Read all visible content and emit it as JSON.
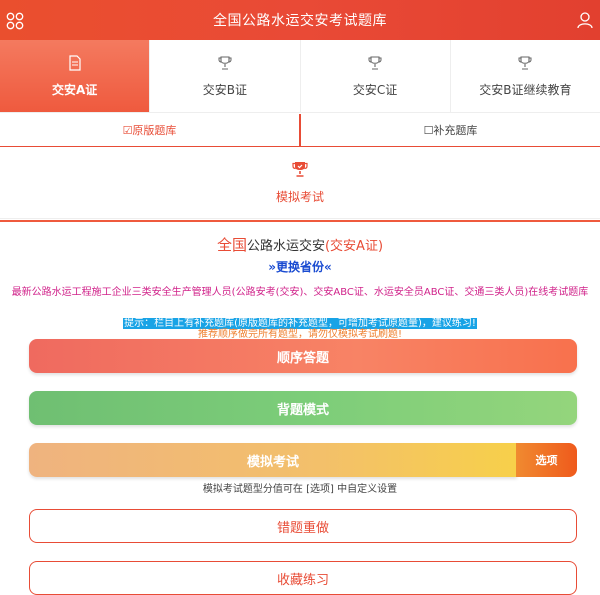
{
  "header": {
    "title": "全国公路水运交安考试题库"
  },
  "tabs": [
    {
      "label": "交安A证",
      "active": true
    },
    {
      "label": "交安B证",
      "active": false
    },
    {
      "label": "交安C证",
      "active": false
    },
    {
      "label": "交安B证继续教育",
      "active": false
    }
  ],
  "subtabs": [
    {
      "label": "☑原版题库",
      "active": true
    },
    {
      "label": "☐补充题库",
      "active": false
    }
  ],
  "mock_exam_tab": {
    "label": "模拟考试"
  },
  "info": {
    "title_prefix": "全国",
    "title_mid": "公路水运交安",
    "title_suffix": "(交安A证)",
    "change_province": "»更换省份«",
    "description": "最新公路水运工程施工企业三类安全生产管理人员(公路安考(交安)、交安ABC证、水运安全员ABC证、交通三类人员)在线考试题库",
    "hint": "提示：栏目上有补充题库(原版题库的补充题型，可增加考试原题量)，建议练习!",
    "recommend": "推荐顺序做完所有题型，请勿仅模拟考试刷题!"
  },
  "buttons": {
    "sequential": "顺序答题",
    "recite": "背题模式",
    "mock_exam": "模拟考试",
    "options": "选项",
    "mock_note": "模拟考试题型分值可在 [选项] 中自定义设置",
    "wrong": "错题重做",
    "favorites": "收藏练习"
  },
  "colors": {
    "brand": "#e84c36",
    "link": "#1a4bd1",
    "desc": "#d0228a",
    "hint_bg": "#18a3e6"
  }
}
